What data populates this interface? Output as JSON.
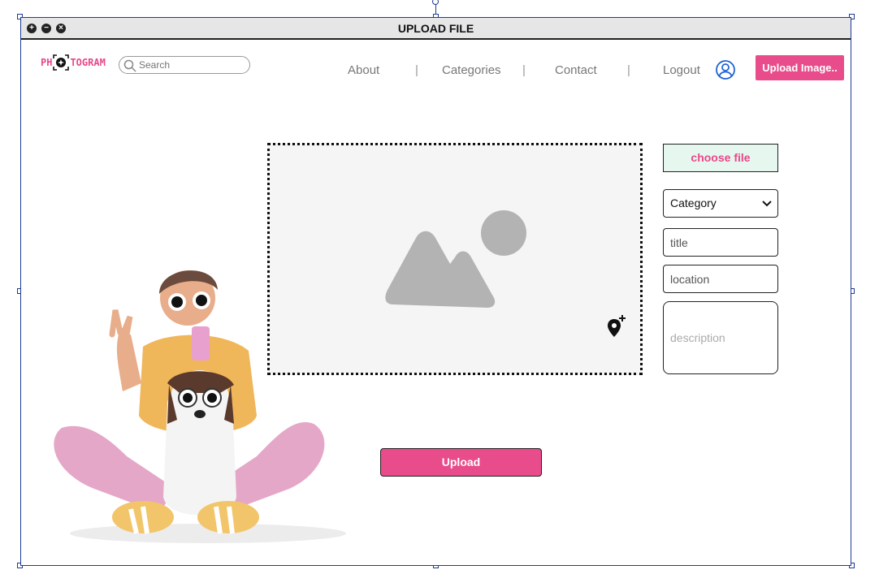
{
  "window": {
    "title": "UPLOAD FILE",
    "controls": [
      "maximize-icon",
      "minimize-icon",
      "close-icon"
    ]
  },
  "header": {
    "logo_text": {
      "before": "PH",
      "after": "TOGRAM"
    },
    "brand_color": "#e8488a",
    "search": {
      "placeholder": "Search",
      "value": ""
    },
    "nav": [
      {
        "label": "About"
      },
      {
        "label": "Categories"
      },
      {
        "label": "Contact"
      },
      {
        "label": "Logout"
      }
    ],
    "nav_separator": "|",
    "user_icon": "user-circle-icon",
    "upload_image_button": "Upload Image.."
  },
  "upload_form": {
    "dropzone_icon": "image-placeholder-icon",
    "add_location_icon": "add-location-icon",
    "choose_file_label": "choose file",
    "category": {
      "selected": "Category"
    },
    "title_placeholder": "title",
    "location_placeholder": "location",
    "description_placeholder": "description",
    "upload_button": "Upload"
  },
  "colors": {
    "accent": "#e84c8b",
    "choose_file_bg": "#e6f7ef",
    "dropzone_bg": "#f5f5f5",
    "selection_border": "#1f3a93"
  }
}
